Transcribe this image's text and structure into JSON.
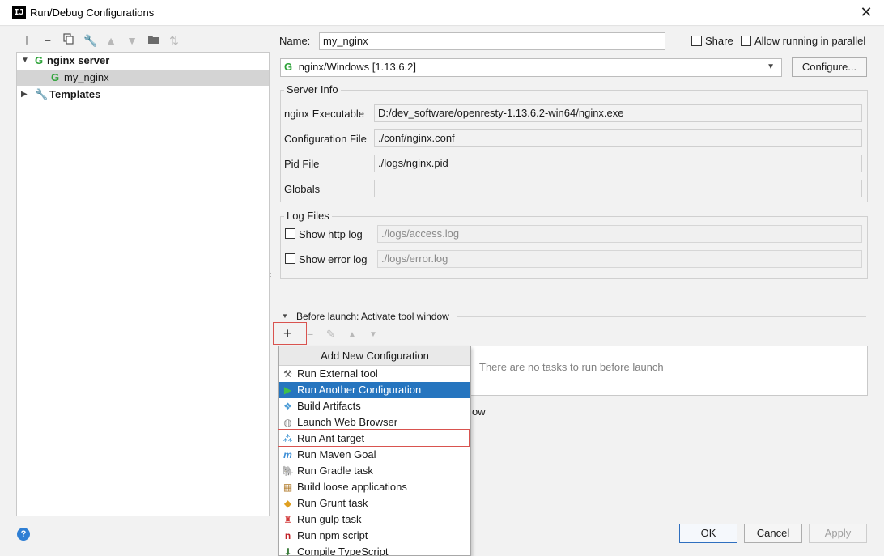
{
  "window": {
    "title": "Run/Debug Configurations",
    "app_icon": "IJ"
  },
  "toolbar": {
    "icons": [
      "plus-icon",
      "minus-icon",
      "copy-icon",
      "wrench-icon",
      "arrow-up-icon",
      "arrow-down-icon",
      "folder-add-icon",
      "sort-icon"
    ]
  },
  "tree": {
    "group_label": "nginx server",
    "item_label": "my_nginx",
    "templates_label": "Templates"
  },
  "form": {
    "name_label": "Name:",
    "name_value": "my_nginx",
    "share_label": "Share",
    "parallel_label": "Allow running in parallel",
    "server_select": "nginx/Windows [1.13.6.2]",
    "configure_button": "Configure...",
    "server_info_title": "Server Info",
    "executable_label": "nginx Executable",
    "executable_value": "D:/dev_software/openresty-1.13.6.2-win64/nginx.exe",
    "config_label": "Configuration File",
    "config_value": "./conf/nginx.conf",
    "pid_label": "Pid File",
    "pid_value": "./logs/nginx.pid",
    "globals_label": "Globals",
    "globals_value": "",
    "log_files_title": "Log Files",
    "http_log_label": "Show http log",
    "http_log_value": "./logs/access.log",
    "error_log_label": "Show error log",
    "error_log_value": "./logs/error.log",
    "before_launch_label": "Before launch: Activate tool window",
    "no_tasks_text": "There are no tasks to run before launch",
    "partial_text": "ow"
  },
  "popup": {
    "header": "Add New Configuration",
    "items": [
      {
        "label": "Run External tool",
        "icon": "external-tool-icon"
      },
      {
        "label": "Run Another Configuration",
        "icon": "run-triangle-icon"
      },
      {
        "label": "Build Artifacts",
        "icon": "artifacts-icon"
      },
      {
        "label": "Launch Web Browser",
        "icon": "web-browser-icon"
      },
      {
        "label": "Run Ant target",
        "icon": "ant-icon"
      },
      {
        "label": "Run Maven Goal",
        "icon": "maven-icon"
      },
      {
        "label": "Run Gradle task",
        "icon": "gradle-icon"
      },
      {
        "label": "Build loose applications",
        "icon": "loose-app-icon"
      },
      {
        "label": "Run Grunt task",
        "icon": "grunt-icon"
      },
      {
        "label": "Run gulp task",
        "icon": "gulp-icon"
      },
      {
        "label": "Run npm script",
        "icon": "npm-icon"
      },
      {
        "label": "Compile TypeScript",
        "icon": "typescript-icon"
      }
    ]
  },
  "buttons": {
    "ok": "OK",
    "cancel": "Cancel",
    "apply": "Apply"
  },
  "colors": {
    "accent": "#2675bf",
    "highlight_box": "#d9534f",
    "green": "#2fa33a"
  }
}
